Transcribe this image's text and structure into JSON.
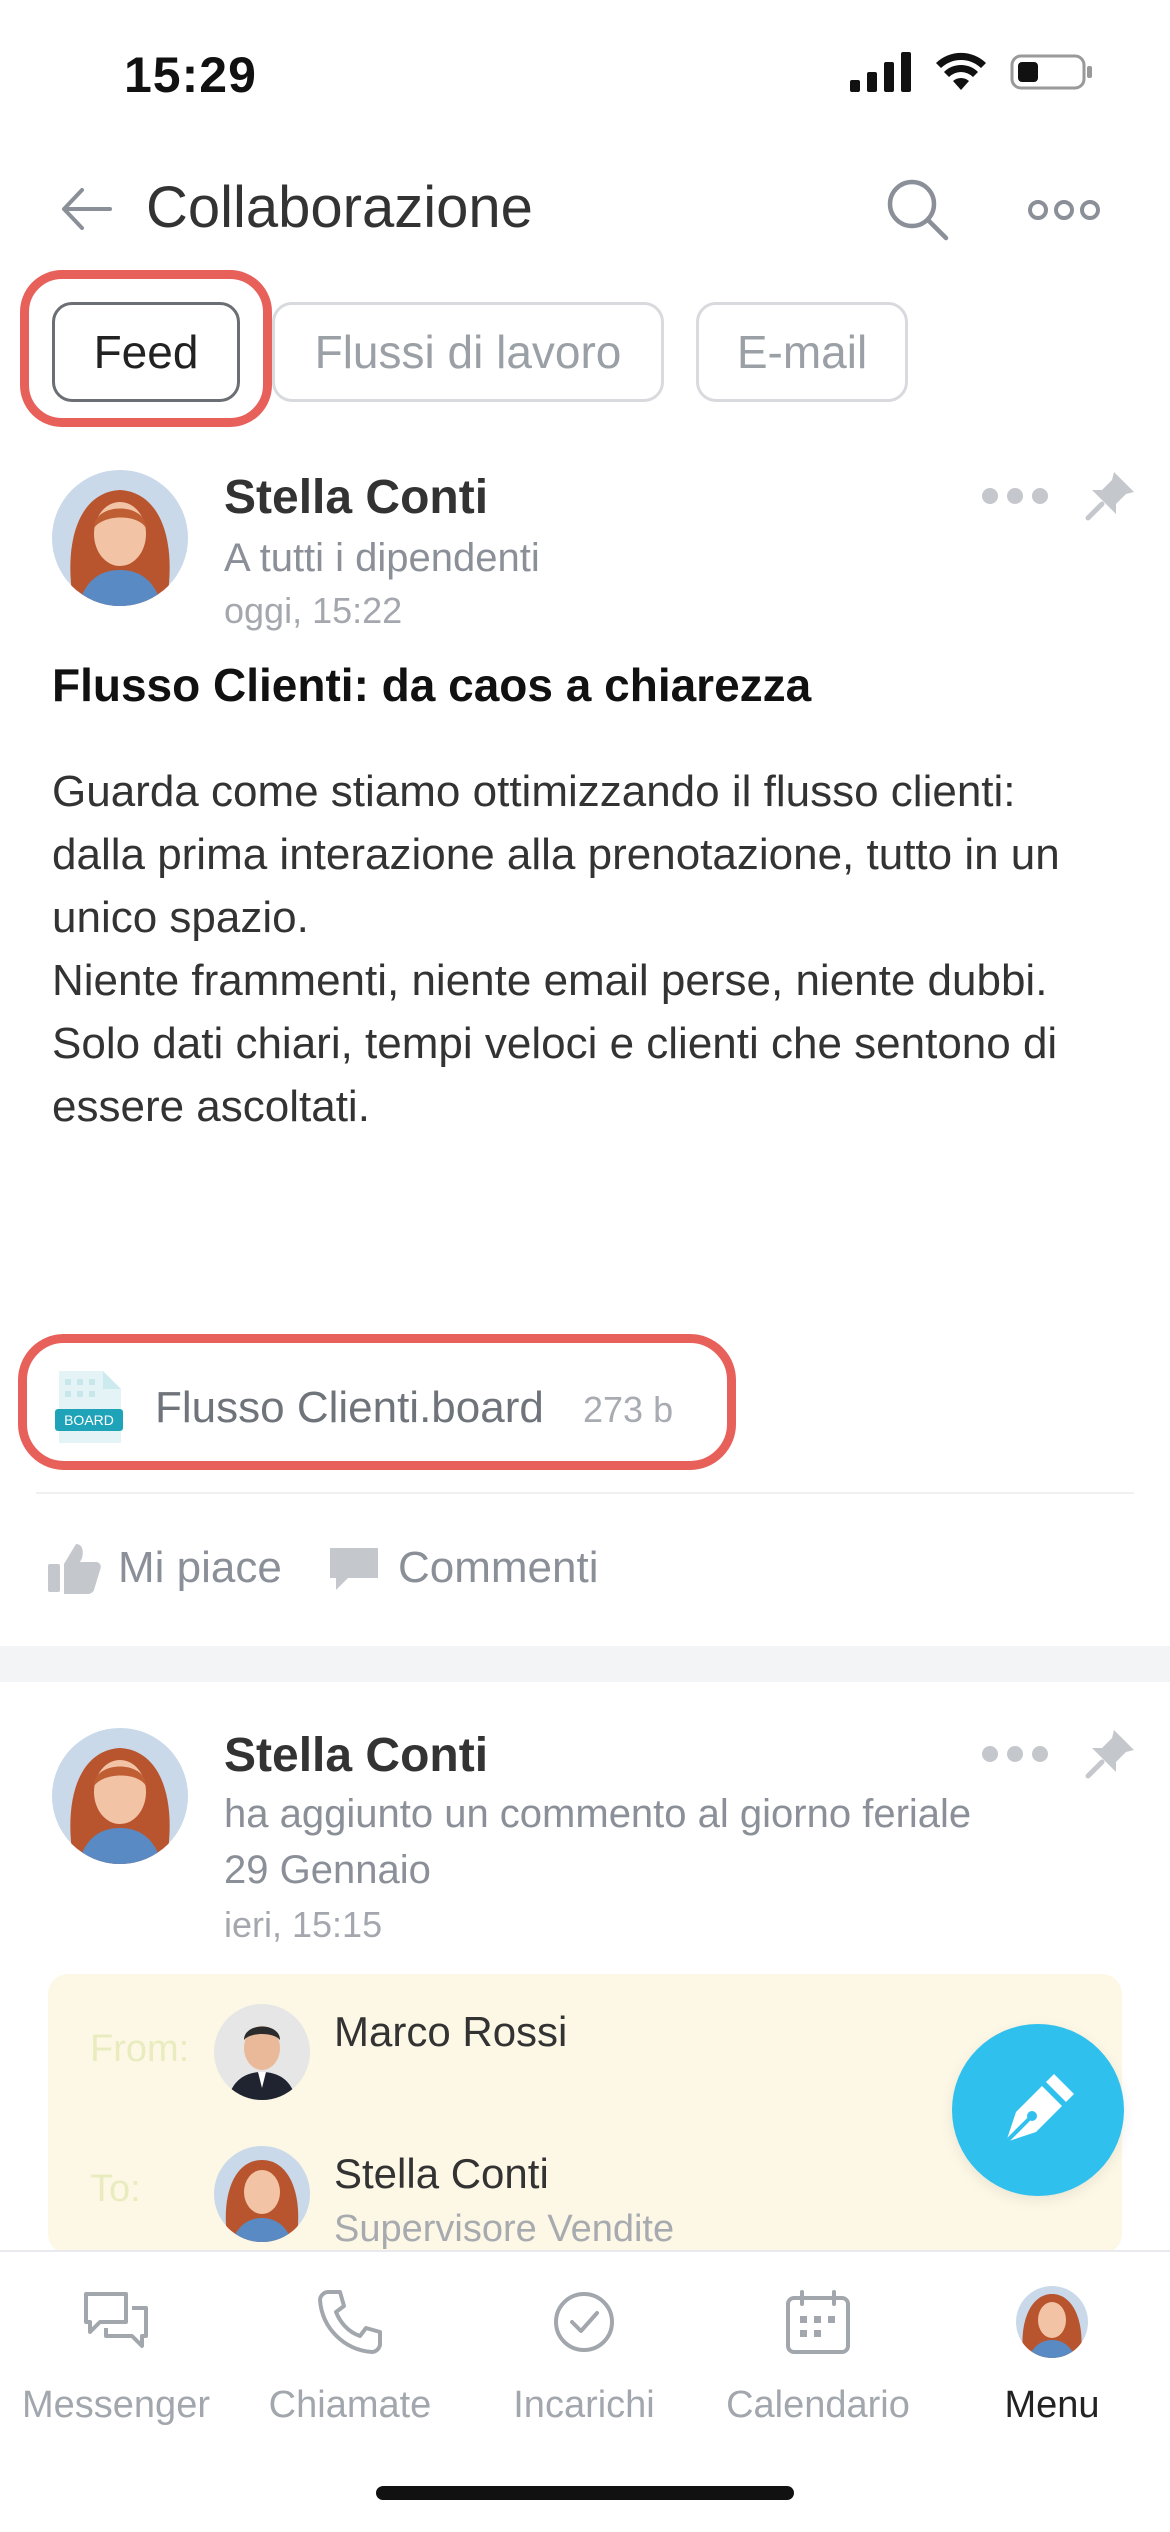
{
  "status": {
    "time": "15:29"
  },
  "header": {
    "title": "Collaborazione"
  },
  "tabs": [
    {
      "label": "Feed"
    },
    {
      "label": "Flussi di lavoro"
    },
    {
      "label": "E-mail"
    }
  ],
  "post1": {
    "author": "Stella Conti",
    "audience": "A tutti i dipendenti",
    "time": "oggi, 15:22",
    "title": "Flusso Clienti: da caos a chiarezza",
    "body": "Guarda come stiamo ottimizzando il flusso clienti:\ndalla prima interazione alla prenotazione, tutto in un unico spazio.\nNiente frammenti, niente email perse, niente dubbi.\nSolo dati chiari, tempi veloci e clienti che sentono di essere ascoltati.",
    "attachment": {
      "name": "Flusso Clienti.board",
      "size": "273 b",
      "icon_text": "BOARD"
    },
    "actions": {
      "like": "Mi piace",
      "comment": "Commenti"
    }
  },
  "post2": {
    "author": "Stella Conti",
    "activity": "ha aggiunto un commento al giorno feriale 29 Gennaio",
    "time": "ieri, 15:15",
    "email": {
      "from_label": "From:",
      "from_name": "Marco Rossi",
      "to_label": "To:",
      "to_name": "Stella Conti",
      "to_role": "Supervisore Vendite"
    }
  },
  "nav": [
    {
      "label": "Messenger",
      "icon": "messenger-icon"
    },
    {
      "label": "Chiamate",
      "icon": "phone-icon"
    },
    {
      "label": "Incarichi",
      "icon": "check-circle-icon"
    },
    {
      "label": "Calendario",
      "icon": "calendar-icon"
    },
    {
      "label": "Menu",
      "icon": "avatar"
    }
  ],
  "colors": {
    "highlight": "#e8605a",
    "fab": "#2fc0ee",
    "email_card": "#fdf7e5"
  }
}
